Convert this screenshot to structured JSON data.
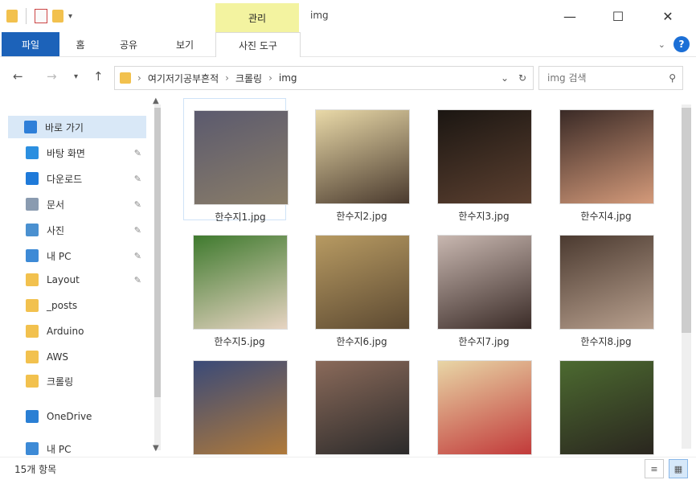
{
  "window": {
    "title": "img",
    "context_tab": "관리",
    "controls": {
      "minimize": "—",
      "maximize": "☐",
      "close": "✕"
    }
  },
  "ribbon": {
    "tabs": [
      "파일",
      "홈",
      "공유",
      "보기",
      "사진 도구"
    ],
    "help": "?"
  },
  "address": {
    "crumbs": [
      "여기저기공부흔적",
      "크롤링",
      "img"
    ],
    "separator": "›"
  },
  "search": {
    "placeholder": "img 검색"
  },
  "sidebar": {
    "items": [
      {
        "label": "바로 가기",
        "icon": "star-icon",
        "color": "#2f7fd8",
        "pinned": false,
        "selected": true
      },
      {
        "label": "바탕 화면",
        "icon": "desktop-icon",
        "color": "#2b8fe0",
        "pinned": true
      },
      {
        "label": "다운로드",
        "icon": "download-icon",
        "color": "#1f7ad9",
        "pinned": true
      },
      {
        "label": "문서",
        "icon": "document-icon",
        "color": "#8a9bb0",
        "pinned": true
      },
      {
        "label": "사진",
        "icon": "pictures-icon",
        "color": "#4a90d0",
        "pinned": true
      },
      {
        "label": "내 PC",
        "icon": "pc-icon",
        "color": "#3d8ad6",
        "pinned": true
      },
      {
        "label": "Layout",
        "icon": "folder-icon",
        "color": "#f2c14e",
        "pinned": true
      },
      {
        "label": "_posts",
        "icon": "folder-icon",
        "color": "#f2c14e",
        "pinned": false
      },
      {
        "label": "Arduino",
        "icon": "folder-icon",
        "color": "#f2c14e",
        "pinned": false
      },
      {
        "label": "AWS",
        "icon": "folder-icon",
        "color": "#f2c14e",
        "pinned": false
      },
      {
        "label": "크롤링",
        "icon": "folder-icon",
        "color": "#f2c14e",
        "pinned": false
      },
      {
        "label": "OneDrive",
        "icon": "cloud-icon",
        "color": "#2a7fd4",
        "pinned": false
      },
      {
        "label": "내 PC",
        "icon": "pc-icon",
        "color": "#3d8ad6",
        "pinned": false
      }
    ]
  },
  "files": [
    {
      "name": "한수지1.jpg",
      "colors": [
        "#5b5a6e",
        "#8a7d68"
      ],
      "selected": true
    },
    {
      "name": "한수지2.jpg",
      "colors": [
        "#e9d9a8",
        "#4a3a2e"
      ]
    },
    {
      "name": "한수지3.jpg",
      "colors": [
        "#1b1612",
        "#5c4030"
      ]
    },
    {
      "name": "한수지4.jpg",
      "colors": [
        "#3a2a26",
        "#d49a7a"
      ]
    },
    {
      "name": "한수지5.jpg",
      "colors": [
        "#3f7a2e",
        "#e7d4c2"
      ]
    },
    {
      "name": "한수지6.jpg",
      "colors": [
        "#b79a62",
        "#5d4a32"
      ]
    },
    {
      "name": "한수지7.jpg",
      "colors": [
        "#c8b7b0",
        "#3b2c28"
      ]
    },
    {
      "name": "한수지8.jpg",
      "colors": [
        "#4b3a30",
        "#b8a08e"
      ]
    },
    {
      "name": "",
      "colors": [
        "#3a4a78",
        "#b07a3a"
      ]
    },
    {
      "name": "",
      "colors": [
        "#8a6a5a",
        "#2b2a2a"
      ]
    },
    {
      "name": "",
      "colors": [
        "#e8d6a6",
        "#c23a3a"
      ]
    },
    {
      "name": "",
      "colors": [
        "#4c6a30",
        "#2a261f"
      ]
    }
  ],
  "status": {
    "text": "15개 항목"
  }
}
